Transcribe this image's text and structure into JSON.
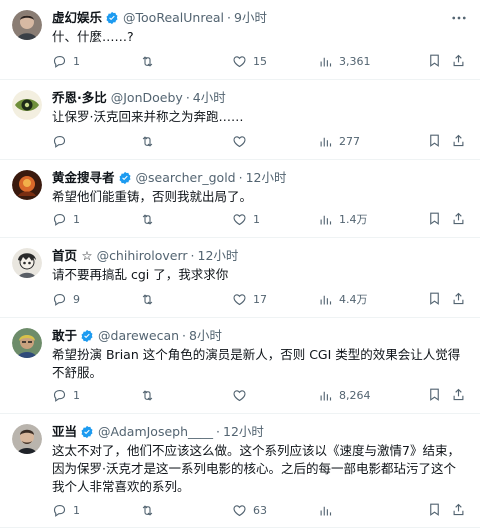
{
  "tweets": [
    {
      "name": "虚幻娱乐",
      "handle": "@TooRealUnreal",
      "dot": "·",
      "time": "9小时",
      "text": "什、什麼……?",
      "verified": true,
      "reply_count": "1",
      "retweet_count": "",
      "like_count": "15",
      "view_count": "3,361"
    },
    {
      "name": "乔恩·多比",
      "handle": "@JonDoeby",
      "dot": "·",
      "time": "4小时",
      "text": "让保罗·沃克回来并称之为奔跑……",
      "verified": false,
      "reply_count": "",
      "retweet_count": "",
      "like_count": "",
      "view_count": "277"
    },
    {
      "name": "黄金搜寻者",
      "handle": "@searcher_gold",
      "dot": "·",
      "time": "12小时",
      "text": "希望他们能重铸，否则我就出局了。",
      "verified": true,
      "reply_count": "1",
      "retweet_count": "",
      "like_count": "1",
      "view_count": "1.4万"
    },
    {
      "name": "首页 ☆",
      "handle": "@chihiroloverr",
      "dot": "·",
      "time": "12小时",
      "text": "请不要再搞乱 cgi 了，我求求你",
      "verified": false,
      "reply_count": "9",
      "retweet_count": "",
      "like_count": "17",
      "view_count": "4.4万"
    },
    {
      "name": "敢于",
      "handle": "@darewecan",
      "dot": "·",
      "time": "8小时",
      "text": "希望扮演 Brian 这个角色的演员是新人，否则 CGI 类型的效果会让人觉得不舒服。",
      "verified": true,
      "reply_count": "1",
      "retweet_count": "",
      "like_count": "",
      "view_count": "8,264"
    },
    {
      "name": "亚当",
      "handle": "@AdamJoseph____",
      "dot": "·",
      "time": "12小时",
      "text": "这太不对了，他们不应该这么做。这个系列应该以《速度与激情7》结束，因为保罗·沃克才是这一系列电影的核心。之后的每一部电影都玷污了这个我个人非常喜欢的系列。",
      "verified": true,
      "reply_count": "1",
      "retweet_count": "",
      "like_count": "63",
      "view_count": ""
    }
  ]
}
